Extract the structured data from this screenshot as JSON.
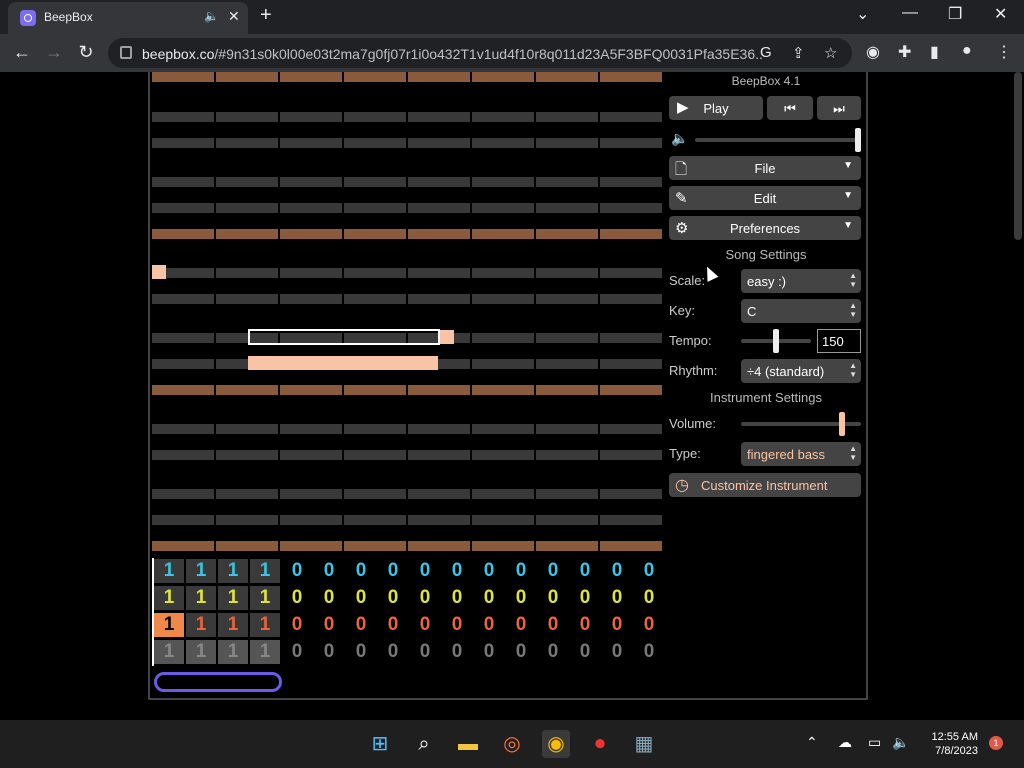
{
  "browser": {
    "tab_title": "BeepBox",
    "tab_audio_icon": "speaker-icon",
    "new_tab": "+",
    "url_host": "beepbox.co",
    "url_rest": "/#9n31s0k0l00e03t2ma7g0fj07r1i0o432T1v1ud4f10r8q011d23A5F3BFQ0031Pfa35E36...",
    "win_minimize": "—",
    "win_restore": "❐",
    "win_close": "✕",
    "win_tabsearch": "⌄"
  },
  "app": {
    "version": "BeepBox 4.1",
    "play_label": "Play",
    "prev_icon": "skip-back-icon",
    "next_icon": "skip-forward-icon",
    "menus": [
      {
        "label": "File",
        "icon": "file-icon"
      },
      {
        "label": "Edit",
        "icon": "pencil-icon"
      },
      {
        "label": "Preferences",
        "icon": "gear-icon"
      }
    ],
    "song_settings_title": "Song Settings",
    "scale_label": "Scale:",
    "scale_value": "easy :)",
    "key_label": "Key:",
    "key_value": "C",
    "tempo_label": "Tempo:",
    "tempo_value": "150",
    "rhythm_label": "Rhythm:",
    "rhythm_value": "÷4 (standard)",
    "instrument_settings_title": "Instrument Settings",
    "volume_label": "Volume:",
    "type_label": "Type:",
    "type_value": "fingered bass",
    "customize_label": "Customize Instrument",
    "colors": {
      "note": "#f9c4a5",
      "octave_row": "#8a5a3d",
      "row": "#393939",
      "channel1": "#3bc4e4",
      "channel2": "#e0e33c",
      "channel3": "#e8663a",
      "channel4": "#777777",
      "scroll_pill": "#6b5ce7"
    }
  },
  "pattern_grid": {
    "channels": [
      [
        "1",
        "1",
        "1",
        "1",
        "0",
        "0",
        "0",
        "0",
        "0",
        "0",
        "0",
        "0",
        "0",
        "0",
        "0",
        "0"
      ],
      [
        "1",
        "1",
        "1",
        "1",
        "0",
        "0",
        "0",
        "0",
        "0",
        "0",
        "0",
        "0",
        "0",
        "0",
        "0",
        "0"
      ],
      [
        "1",
        "1",
        "1",
        "1",
        "0",
        "0",
        "0",
        "0",
        "0",
        "0",
        "0",
        "0",
        "0",
        "0",
        "0",
        "0"
      ],
      [
        "1",
        "1",
        "1",
        "1",
        "0",
        "0",
        "0",
        "0",
        "0",
        "0",
        "0",
        "0",
        "0",
        "0",
        "0",
        "0"
      ]
    ]
  },
  "taskbar": {
    "time": "12:55 AM",
    "date": "7/8/2023",
    "notifications": "1"
  }
}
